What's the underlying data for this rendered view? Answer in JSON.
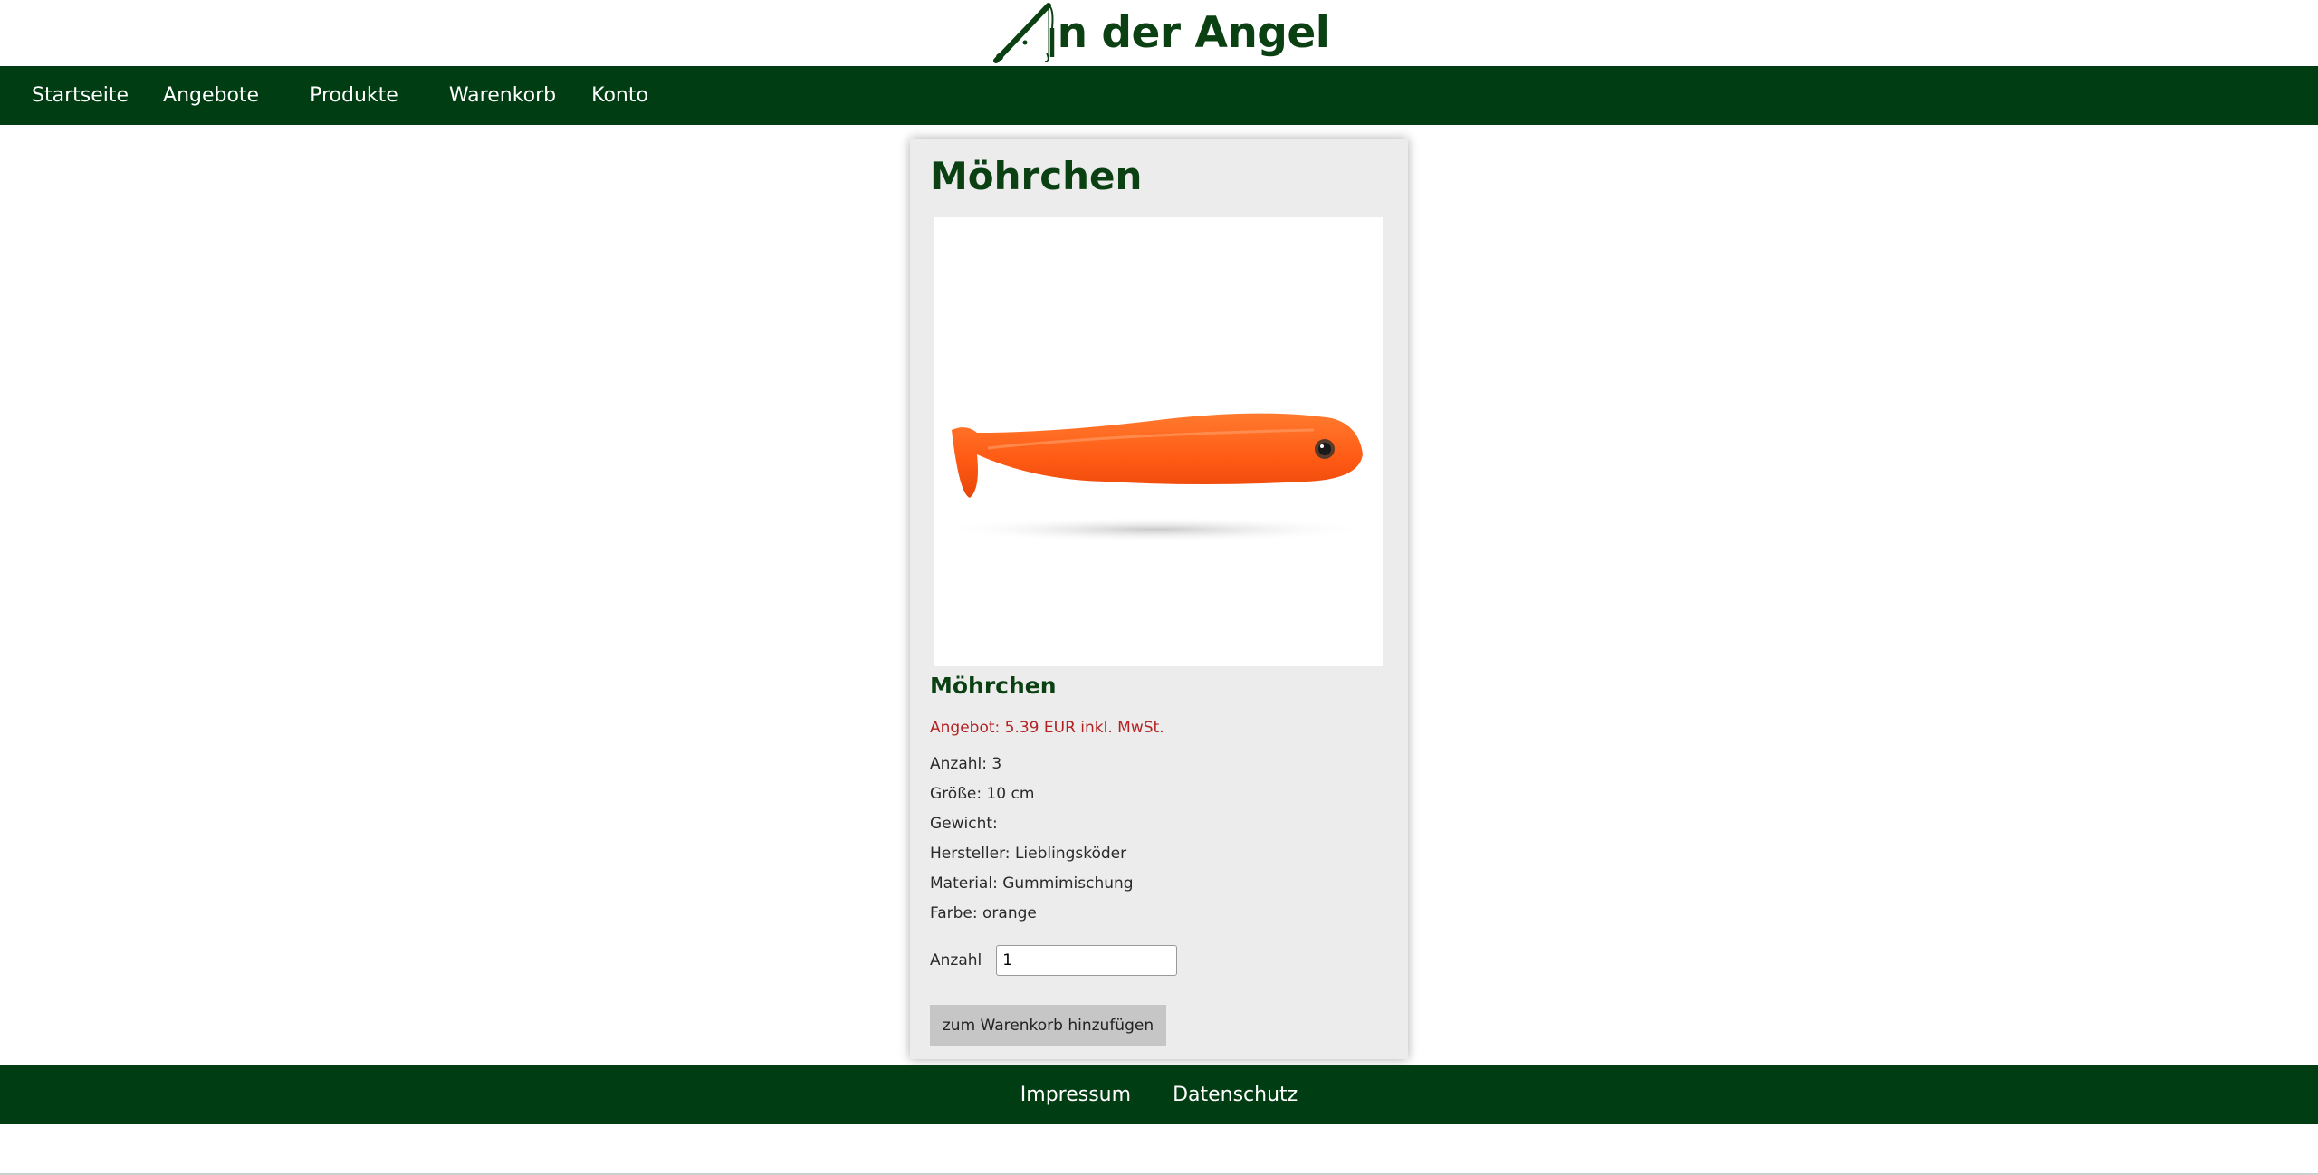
{
  "brand": {
    "logo_text": "n der Angel",
    "color": "#0a4012"
  },
  "nav": {
    "background": "#003d12",
    "items": [
      {
        "label": "Startseite"
      },
      {
        "label": "Angebote"
      },
      {
        "label": "Produkte"
      },
      {
        "label": "Warenkorb"
      },
      {
        "label": "Konto"
      }
    ]
  },
  "product": {
    "title": "Möhrchen",
    "subtitle": "Möhrchen",
    "offer": "Angebot: 5.39 EUR inkl. MwSt.",
    "details": [
      "Anzahl: 3",
      "Größe: 10 cm",
      "Gewicht:",
      "Hersteller: Lieblingsköder",
      "Material: Gummimischung",
      "Farbe: orange"
    ],
    "quantity_label": "Anzahl",
    "quantity_value": "1",
    "add_to_cart": "zum Warenkorb hinzufügen",
    "lure_color": "#ff5a14",
    "offer_color": "#b22222"
  },
  "footer": {
    "links": [
      {
        "label": "Impressum"
      },
      {
        "label": "Datenschutz"
      }
    ]
  },
  "icons": {
    "logo": "fishing-rod-a-icon",
    "product_image": "orange-soft-lure-image"
  }
}
